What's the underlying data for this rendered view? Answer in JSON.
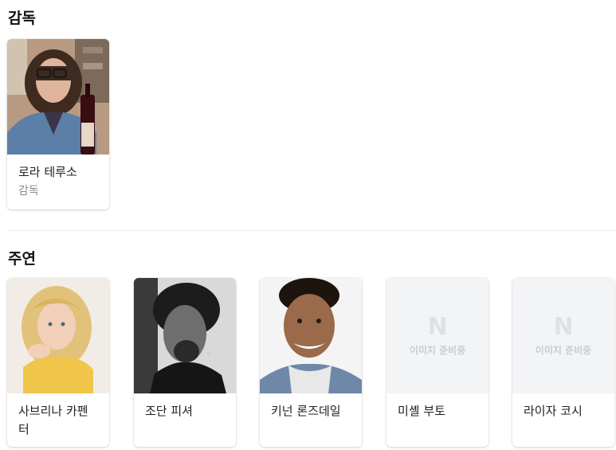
{
  "sections": {
    "director": {
      "title": "감독",
      "people": [
        {
          "name": "로라 테루소",
          "role": "감독",
          "has_photo": true
        }
      ]
    },
    "cast": {
      "title": "주연",
      "people": [
        {
          "name": "사브리나 카펜터",
          "has_photo": true
        },
        {
          "name": "조단 피셔",
          "has_photo": true
        },
        {
          "name": "키넌 론즈데일",
          "has_photo": true
        },
        {
          "name": "미셸 부토",
          "has_photo": false
        },
        {
          "name": "라이자 코시",
          "has_photo": false
        }
      ]
    }
  },
  "placeholder": {
    "logo": "N",
    "text": "이미지 준비중"
  },
  "colors": {
    "placeholder_bg": "#f3f4f6",
    "placeholder_fg": "#dfe1e5",
    "role_text": "#8a8a8a"
  }
}
